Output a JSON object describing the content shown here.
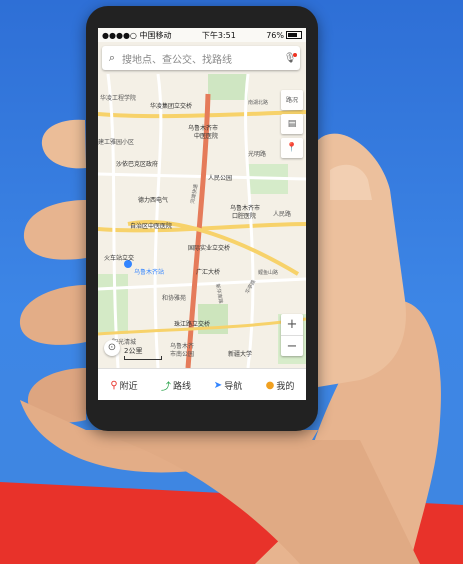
{
  "status": {
    "carrier": "●●●●○ 中国移动 ",
    "time": "下午3:51",
    "battery": "76%"
  },
  "search": {
    "placeholder": "搜地点、查公交、找路线"
  },
  "tools": {
    "traffic": "路况"
  },
  "map": {
    "labels": {
      "l1": "华凌集团立交桥",
      "l2": "乌鲁木齐市",
      "l3": "中医医院",
      "l4": "光明路",
      "l5": "沙依巴克区政府",
      "l6": "人民公园",
      "l7": "德力西电气",
      "l8": "乌鲁木齐市",
      "l9": "口腔医院",
      "l10": "自治区中医医院",
      "l11": "国际实业立交桥",
      "l12": "火车站立交",
      "l13": "乌鲁木齐站",
      "l14": "广汇大桥",
      "l15": "和协雅苑",
      "l16": "珠江路立交桥",
      "l17": "阳光清城",
      "l18": "乌鲁木齐",
      "l19": "市南公园",
      "l20": "新疆大学",
      "l21": "华凌工程学院",
      "l22": "人民路",
      "l23": "河滩快速",
      "l24": "新华南路",
      "l25": "华亭路",
      "l26": "西山路",
      "l27": "友好路",
      "l28": "延安路",
      "l29": "建工雅园小区",
      "l30": "苏州路",
      "l31": "南湖北路",
      "l32": "鲤鱼山路"
    }
  },
  "scale": {
    "label": "2公里"
  },
  "bottom": {
    "nearby": "附近",
    "route": "路线",
    "navigate": "导航",
    "mine": "我的"
  },
  "colors": {
    "accent": "#3385ff",
    "red": "#e8322a",
    "bg": "#3d86e6"
  }
}
